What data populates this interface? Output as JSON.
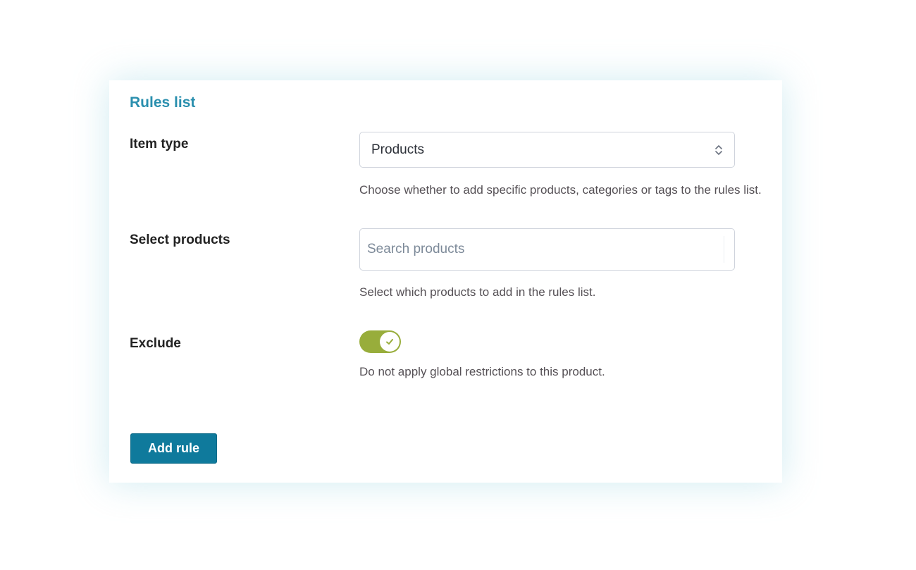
{
  "panel": {
    "title": "Rules list"
  },
  "fields": {
    "item_type": {
      "label": "Item type",
      "value": "Products",
      "help": "Choose whether to add specific products, categories or tags to the rules list."
    },
    "select_products": {
      "label": "Select products",
      "placeholder": "Search products",
      "help": "Select which products to add in the rules list."
    },
    "exclude": {
      "label": "Exclude",
      "enabled": true,
      "help": "Do not apply global restrictions to this product."
    }
  },
  "actions": {
    "add_rule_label": "Add rule"
  },
  "colors": {
    "title": "#2a8fae",
    "toggle_on": "#98ad3b",
    "button": "#0f7a9c"
  },
  "icons": {
    "select": "chevron-up-down-icon",
    "toggle": "check-icon"
  }
}
